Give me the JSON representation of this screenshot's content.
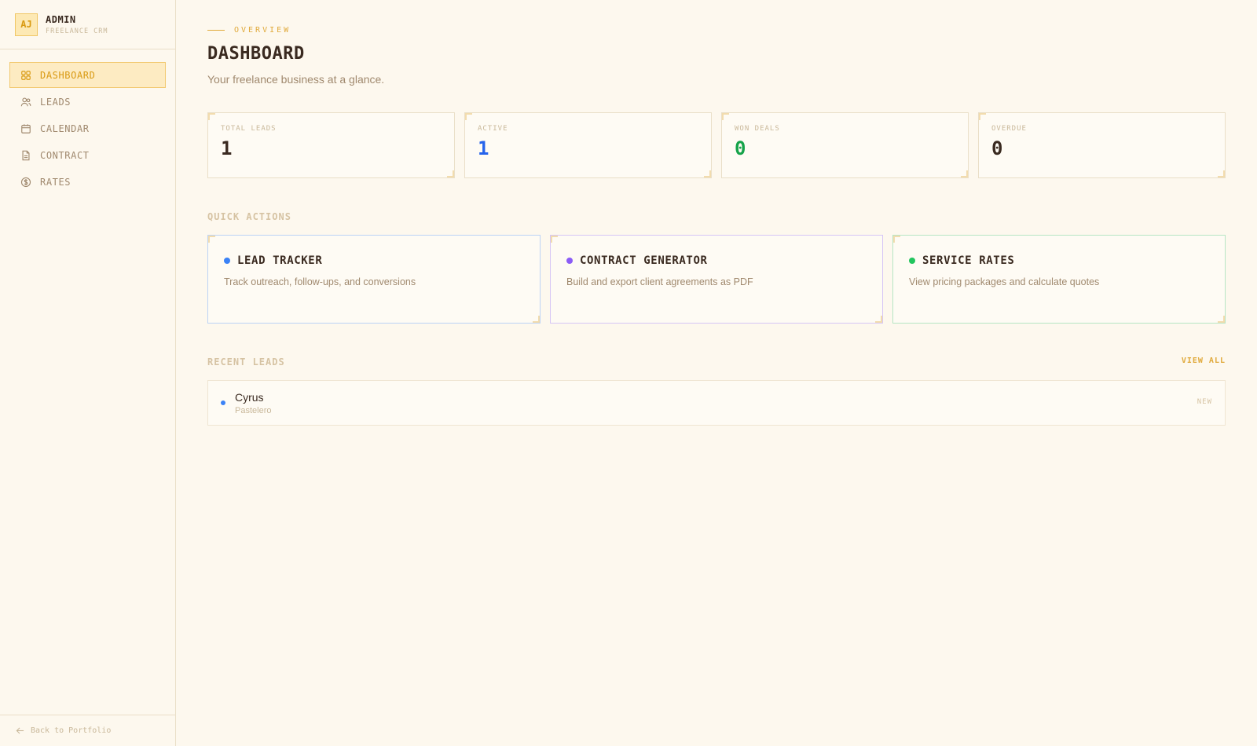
{
  "sidebar": {
    "avatar": "AJ",
    "brand_name": "ADMIN",
    "brand_sub": "FREELANCE CRM",
    "items": [
      {
        "label": "DASHBOARD",
        "icon": "grid-icon",
        "active": true
      },
      {
        "label": "LEADS",
        "icon": "users-icon",
        "active": false
      },
      {
        "label": "CALENDAR",
        "icon": "calendar-icon",
        "active": false
      },
      {
        "label": "CONTRACT",
        "icon": "document-icon",
        "active": false
      },
      {
        "label": "RATES",
        "icon": "dollar-icon",
        "active": false
      }
    ],
    "back_label": "Back to Portfolio"
  },
  "header": {
    "eyebrow": "OVERVIEW",
    "title": "DASHBOARD",
    "subtitle": "Your freelance business at a glance."
  },
  "stats": [
    {
      "label": "TOTAL LEADS",
      "value": "1",
      "color": "#3a2a20"
    },
    {
      "label": "ACTIVE",
      "value": "1",
      "color": "#2563eb"
    },
    {
      "label": "WON DEALS",
      "value": "0",
      "color": "#16a34a"
    },
    {
      "label": "OVERDUE",
      "value": "0",
      "color": "#3a2a20"
    }
  ],
  "quick_actions": {
    "title": "QUICK ACTIONS",
    "items": [
      {
        "title": "LEAD TRACKER",
        "desc": "Track outreach, follow-ups, and conversions",
        "color": "#3b82f6",
        "border": "#bcd3f5"
      },
      {
        "title": "CONTRACT GENERATOR",
        "desc": "Build and export client agreements as PDF",
        "color": "#8b5cf6",
        "border": "#d6c6f5"
      },
      {
        "title": "SERVICE RATES",
        "desc": "View pricing packages and calculate quotes",
        "color": "#22c55e",
        "border": "#b6e6c4"
      }
    ]
  },
  "recent_leads": {
    "title": "RECENT LEADS",
    "view_all": "VIEW ALL",
    "items": [
      {
        "name": "Cyrus",
        "sub": "Pastelero",
        "status": "NEW"
      }
    ]
  }
}
